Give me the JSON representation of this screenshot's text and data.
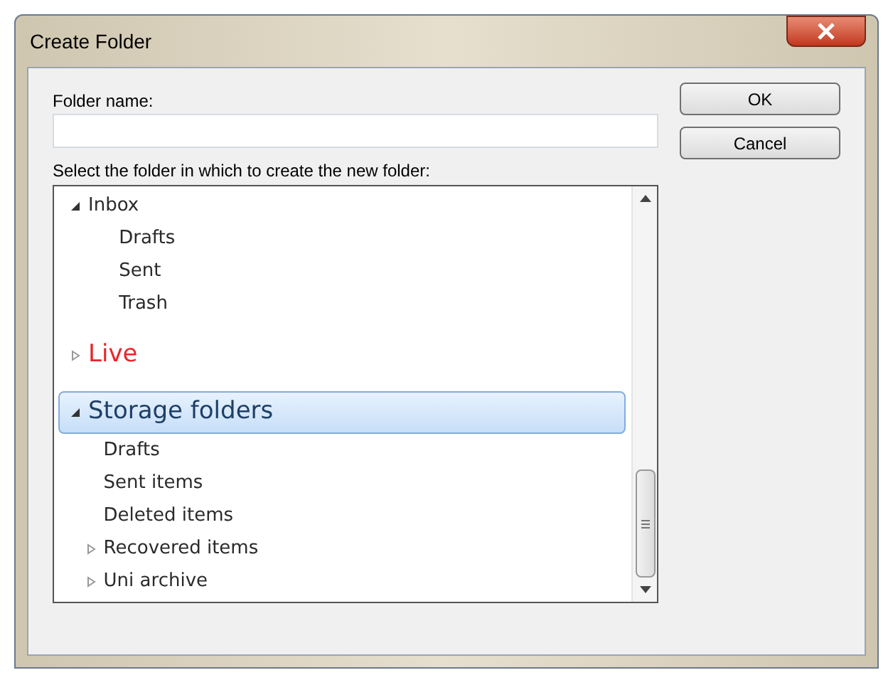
{
  "window": {
    "title": "Create Folder"
  },
  "folder_name": {
    "label": "Folder name:"
  },
  "tree_label": "Select the folder in which to create the new folder:",
  "tree": [
    {
      "label": "Inbox",
      "expanded": true,
      "selected": false,
      "children": [
        {
          "label": "Drafts",
          "selected": false
        },
        {
          "label": "Sent",
          "selected": false
        },
        {
          "label": "Trash",
          "selected": false
        }
      ]
    },
    {
      "label": "Live",
      "kind": "account",
      "color": "#e8262b",
      "expanded": false,
      "selected": false
    },
    {
      "label": "Storage folders",
      "kind": "account",
      "color": "#1e3f66",
      "expanded": true,
      "selected": true,
      "children": [
        {
          "label": "Drafts",
          "selected": false
        },
        {
          "label": "Sent items",
          "selected": false
        },
        {
          "label": "Deleted items",
          "selected": false
        },
        {
          "label": "Recovered items",
          "expanded": false,
          "selected": false
        },
        {
          "label": "Uni archive",
          "expanded": false,
          "selected": false
        }
      ]
    }
  ],
  "buttons": [
    "OK",
    "Cancel"
  ]
}
